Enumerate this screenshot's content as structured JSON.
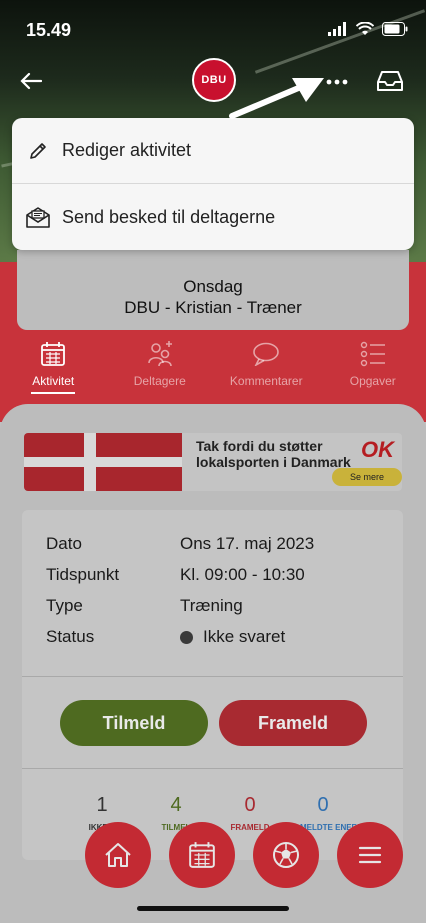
{
  "status_bar": {
    "time": "15.49"
  },
  "header": {
    "logo_text": "DBU"
  },
  "menu": {
    "items": [
      {
        "label": "Rediger aktivitet",
        "icon": "pencil-icon"
      },
      {
        "label": "Send besked til deltagerne",
        "icon": "mail-icon"
      }
    ]
  },
  "activity": {
    "day": "Onsdag",
    "name": "DBU - Kristian - Træner"
  },
  "tabs": [
    {
      "label": "Aktivitet",
      "icon": "calendar-icon",
      "active": true
    },
    {
      "label": "Deltagere",
      "icon": "participants-icon",
      "active": false
    },
    {
      "label": "Kommentarer",
      "icon": "comment-icon",
      "active": false
    },
    {
      "label": "Opgaver",
      "icon": "list-icon",
      "active": false
    }
  ],
  "banner": {
    "text": "Tak fordi du støtter lokalsporten i Danmark",
    "brand": "OK",
    "cta": "Se mere"
  },
  "details": {
    "rows": [
      {
        "label": "Dato",
        "value": "Ons 17. maj 2023"
      },
      {
        "label": "Tidspunkt",
        "value": "Kl. 09:00 - 10:30"
      },
      {
        "label": "Type",
        "value": "Træning"
      },
      {
        "label": "Status",
        "value": "Ikke svaret"
      }
    ],
    "signup_label": "Tilmeld",
    "decline_label": "Frameld"
  },
  "stats": [
    {
      "value": "1",
      "label": "IKKE S",
      "color": "#333333"
    },
    {
      "value": "4",
      "label": "TILMEL",
      "color": "#4e6a20"
    },
    {
      "value": "0",
      "label": "FRAMELD",
      "color": "#a82a31"
    },
    {
      "value": "0",
      "label": "TILMELDTE ENERE",
      "color": "#2f6fb0"
    }
  ],
  "bottom_nav": [
    {
      "icon": "home-icon"
    },
    {
      "icon": "calendar-icon"
    },
    {
      "icon": "football-icon"
    },
    {
      "icon": "menu-icon"
    }
  ],
  "colors": {
    "brand_red": "#c8333b",
    "signup_green": "#4e6a20",
    "decline_red": "#a82a31"
  }
}
